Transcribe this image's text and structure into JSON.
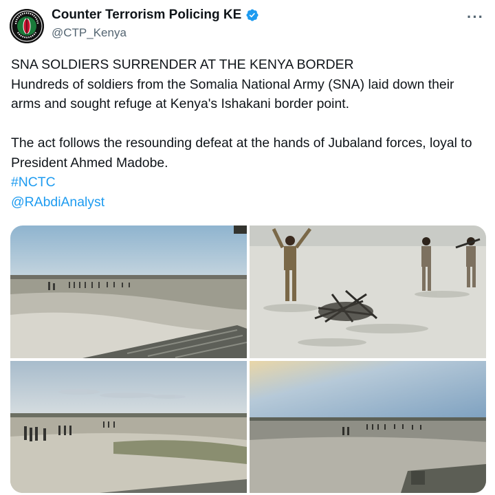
{
  "account": {
    "display_name": "Counter Terrorism Policing KE",
    "handle": "@CTP_Kenya",
    "avatar_text_top": "COUNTER TERRORISM",
    "avatar_text_bottom": "POLICING",
    "verified": true
  },
  "more_icon": "more-horizontal-icon",
  "tweet": {
    "headline": "SNA SOLDIERS SURRENDER AT THE KENYA BORDER",
    "line1": "Hundreds of soldiers from the Somalia National Army (SNA) laid down their arms and sought refuge at Kenya's Ishakani border point.",
    "line2": "The act follows the resounding defeat at the hands of Jubaland forces, loyal to President Ahmed Madobe.",
    "hashtag": "#NCTC",
    "mention": "@RAbdiAnalyst"
  },
  "colors": {
    "link": "#1d9bf0",
    "verified_badge": "#1d9bf0",
    "secondary_text": "#536471"
  },
  "media": [
    {
      "id": "photo-1"
    },
    {
      "id": "photo-2"
    },
    {
      "id": "photo-3"
    },
    {
      "id": "photo-4"
    }
  ]
}
